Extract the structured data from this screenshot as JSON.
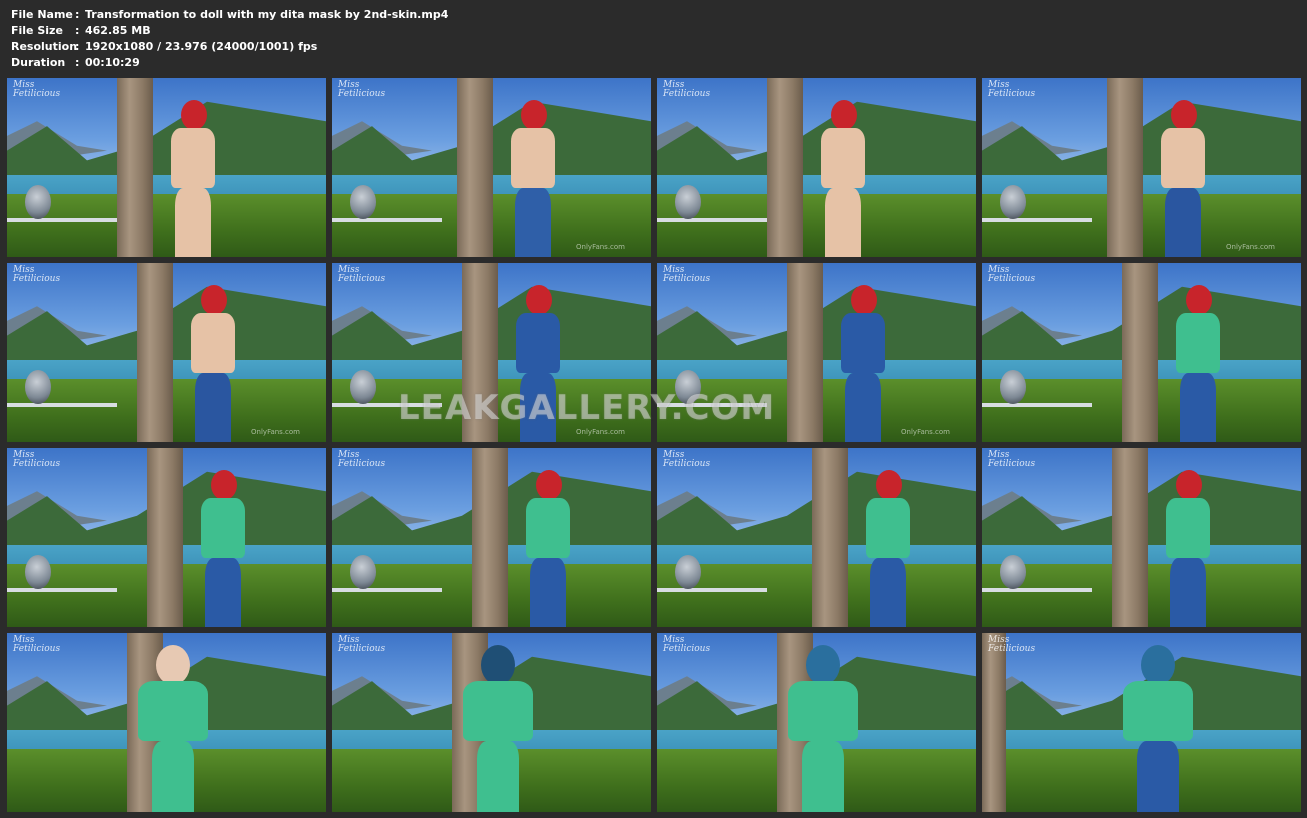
{
  "file_info": {
    "file_name_label": "File Name",
    "file_name_value": "Transformation to doll with my dita mask by 2nd-skin.mp4",
    "file_size_label": "File Size",
    "file_size_value": "462.85 MB",
    "resolution_label": "Resolution",
    "resolution_value": "1920x1080 / 23.976 (24000/1001) fps",
    "duration_label": "Duration",
    "duration_value": "00:10:29",
    "separator": ":"
  },
  "site_watermark": "LEAKGALLERY.COM",
  "thumb_logo": "Miss\nFetilicious",
  "thumb_corner_mark": "OnlyFans.com",
  "thumbnails": [
    {
      "skin": "#e6c2a6",
      "hair": "#c8242b",
      "outfit": "#e6c2a6",
      "top": "#e6c2a6"
    },
    {
      "skin": "#e6c2a6",
      "hair": "#c8242b",
      "outfit": "#2f5fa8",
      "top": "#e6c2a6"
    },
    {
      "skin": "#e6c2a6",
      "hair": "#c8242b",
      "outfit": "#e6c2a6",
      "top": "#e6c2a6"
    },
    {
      "skin": "#e6c2a6",
      "hair": "#c8242b",
      "outfit": "#2a56a0",
      "top": "#e6c2a6"
    },
    {
      "skin": "#e6c2a6",
      "hair": "#c8242b",
      "outfit": "#2a56a0",
      "top": "#e6c2a6"
    },
    {
      "skin": "#e6c2a6",
      "hair": "#c8242b",
      "outfit": "#2a5aa6",
      "top": "#2a5aa6"
    },
    {
      "skin": "#e6c2a6",
      "hair": "#c8242b",
      "outfit": "#2a5aa6",
      "top": "#2a5aa6"
    },
    {
      "skin": "#e6c2a6",
      "hair": "#c8242b",
      "outfit": "#2a5aa6",
      "top": "#3fbf8f"
    },
    {
      "skin": "#e6c2a6",
      "hair": "#c8242b",
      "outfit": "#2a5aa6",
      "top": "#3fbf8f"
    },
    {
      "skin": "#e6c2a6",
      "hair": "#c8242b",
      "outfit": "#2a5aa6",
      "top": "#3fbf8f"
    },
    {
      "skin": "#e6c2a6",
      "hair": "#c8242b",
      "outfit": "#2a5aa6",
      "top": "#3fbf8f"
    },
    {
      "skin": "#e6c2a6",
      "hair": "#c8242b",
      "outfit": "#2a5aa6",
      "top": "#3fbf8f"
    },
    {
      "skin": "#e7c9b3",
      "hair": "#e7c9b3",
      "outfit": "#3fbf8f",
      "top": "#3fbf8f"
    },
    {
      "skin": "#e7c9b3",
      "hair": "#1f4f75",
      "outfit": "#3fbf8f",
      "top": "#3fbf8f"
    },
    {
      "skin": "#e7c9b3",
      "hair": "#2a6f9e",
      "outfit": "#3fbf8f",
      "top": "#3fbf8f"
    },
    {
      "skin": "#e7c9b3",
      "hair": "#2a6f9e",
      "outfit": "#2a5aa6",
      "top": "#3fbf8f"
    }
  ]
}
